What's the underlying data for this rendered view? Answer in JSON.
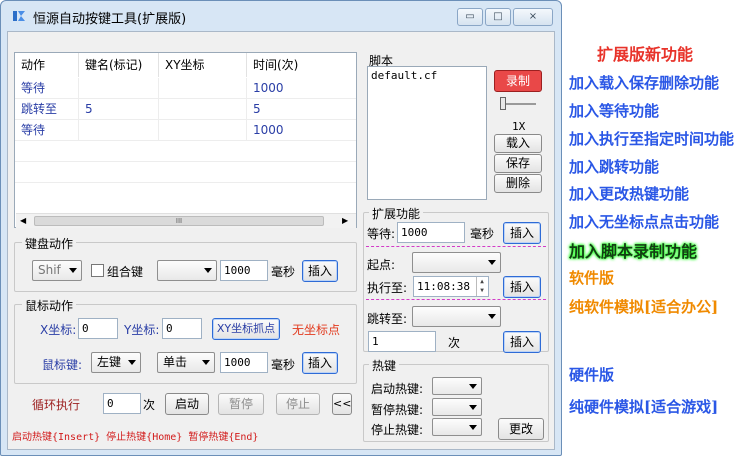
{
  "window": {
    "title": "恒源自动按键工具(扩展版)",
    "caption_buttons": [
      "▭",
      "□",
      "×"
    ]
  },
  "list": {
    "headers": [
      "动作",
      "键名(标记)",
      "XY坐标",
      "时间(次)"
    ],
    "rows": [
      [
        "等待",
        "",
        "",
        "1000"
      ],
      [
        "跳转至",
        "5",
        "",
        "5"
      ],
      [
        "等待",
        "",
        "",
        "1000"
      ]
    ],
    "scroll_grip": "III"
  },
  "script": {
    "label": "脚本",
    "file": "default.cf",
    "record_button": "录制",
    "speed": "1X",
    "load_button": "载入",
    "save_button": "保存",
    "delete_button": "删除"
  },
  "keyboard": {
    "label": "键盘动作",
    "key_combo": "Shif",
    "combo_label": "组合键",
    "action_combo": "",
    "ms_value": "1000",
    "ms_unit": "毫秒",
    "insert_button": "插入"
  },
  "mouse": {
    "label": "鼠标动作",
    "x_label": "X坐标:",
    "x_value": "0",
    "y_label": "Y坐标:",
    "y_value": "0",
    "pick_button": "XY坐标抓点",
    "no_coord": "无坐标点",
    "key_label": "鼠标键:",
    "button_combo": "左键",
    "click_combo": "单击",
    "ms_value": "1000",
    "ms_unit": "毫秒",
    "insert_button": "插入"
  },
  "bottom": {
    "loop_label": "循环执行",
    "loop_value": "0",
    "loop_unit": "次",
    "start_button": "启动",
    "pause_button": "暂停",
    "stop_button": "停止",
    "collapse_button": "<<",
    "hotkey_status": "启动热键{Insert} 停止热键{Home} 暂停热键{End}"
  },
  "extended": {
    "label": "扩展功能",
    "wait_label": "等待:",
    "wait_value": "1000",
    "wait_unit": "毫秒",
    "wait_insert": "插入",
    "start_label": "起点:",
    "exec_label": "执行至:",
    "exec_time": "11:08:38",
    "exec_insert": "插入",
    "jump_label": "跳转至:",
    "jump_count": "1",
    "jump_unit": "次",
    "jump_insert": "插入"
  },
  "hotkeys": {
    "label": "热键",
    "start_label": "启动热键:",
    "pause_label": "暂停热键:",
    "stop_label": "停止热键:",
    "change_button": "更改"
  },
  "annotations": [
    {
      "text": "扩展版新功能",
      "color": "#e8332a"
    },
    {
      "text": "加入载入保存删除功能",
      "color": "#2a57e6"
    },
    {
      "text": "加入等待功能",
      "color": "#2a57e6"
    },
    {
      "text": "加入执行至指定时间功能",
      "color": "#2a57e6"
    },
    {
      "text": "加入跳转功能",
      "color": "#2a57e6"
    },
    {
      "text": "加入更改热键功能",
      "color": "#2a57e6"
    },
    {
      "text": "加入无坐标点点击功能",
      "color": "#2a57e6"
    },
    {
      "text": "加入脚本录制功能",
      "color": "#123e12"
    },
    {
      "text": "软件版",
      "color": "#f08a00"
    },
    {
      "text": "纯软件模拟[适合办公]",
      "color": "#f08a00"
    },
    {
      "text": "硬件版",
      "color": "#2a57e6"
    },
    {
      "text": "纯硬件模拟[适合游戏]",
      "color": "#2a57e6"
    }
  ]
}
